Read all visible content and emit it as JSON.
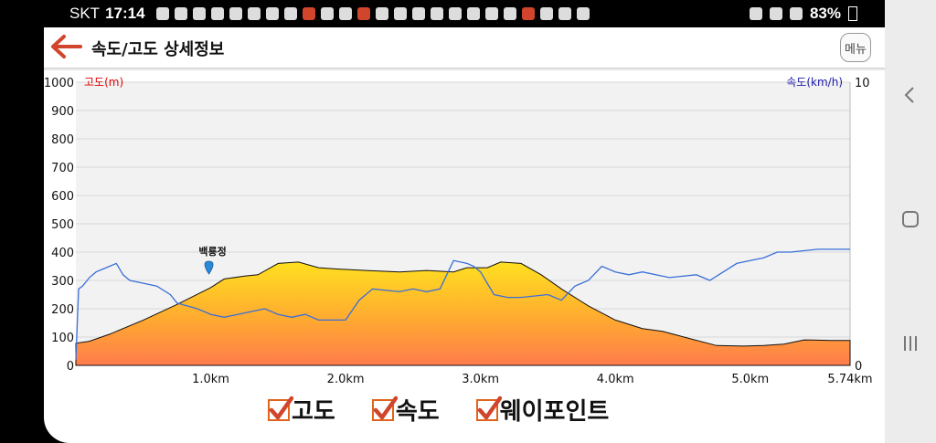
{
  "status_bar": {
    "carrier": "SKT",
    "time": "17:14",
    "battery": "83%"
  },
  "header": {
    "title": "속도/고도 상세정보",
    "menu_label": "메뉴"
  },
  "chart_data": {
    "type": "area",
    "left_axis": {
      "label": "고도(m)",
      "ticks": [
        "1000",
        "900",
        "800",
        "700",
        "600",
        "500",
        "400",
        "300",
        "200",
        "100",
        "0"
      ],
      "range": [
        0,
        1000
      ],
      "color": "#e00000"
    },
    "right_axis": {
      "label": "속도(km/h)",
      "ticks": [
        "10",
        "0"
      ],
      "range": [
        0,
        10
      ],
      "color": "#1a1aa8"
    },
    "x_ticks": [
      "1.0km",
      "2.0km",
      "3.0km",
      "4.0km",
      "5.0km",
      "5.74km"
    ],
    "x_range": [
      0,
      5.74
    ],
    "grid": true,
    "series": [
      {
        "key": "altitude",
        "x": [
          0,
          0.1,
          0.25,
          0.5,
          0.75,
          1.0,
          1.1,
          1.25,
          1.35,
          1.5,
          1.65,
          1.8,
          1.95,
          2.15,
          2.4,
          2.6,
          2.8,
          2.9,
          3.05,
          3.15,
          3.3,
          3.45,
          3.6,
          3.8,
          4.0,
          4.2,
          4.35,
          4.55,
          4.75,
          4.95,
          5.1,
          5.25,
          5.4,
          5.6,
          5.74
        ],
        "values": [
          78,
          85,
          110,
          160,
          215,
          275,
          305,
          315,
          320,
          360,
          365,
          345,
          340,
          335,
          330,
          335,
          330,
          345,
          345,
          365,
          360,
          320,
          270,
          210,
          160,
          130,
          120,
          95,
          70,
          68,
          70,
          75,
          90,
          88,
          88
        ]
      },
      {
        "key": "speed",
        "x": [
          0,
          0.02,
          0.05,
          0.1,
          0.15,
          0.2,
          0.3,
          0.35,
          0.4,
          0.5,
          0.6,
          0.7,
          0.75,
          0.9,
          1.0,
          1.1,
          1.2,
          1.3,
          1.4,
          1.5,
          1.6,
          1.7,
          1.8,
          2.0,
          2.1,
          2.2,
          2.4,
          2.5,
          2.6,
          2.7,
          2.8,
          2.9,
          2.95,
          3.0,
          3.1,
          3.2,
          3.3,
          3.5,
          3.6,
          3.7,
          3.8,
          3.9,
          4.0,
          4.1,
          4.2,
          4.4,
          4.6,
          4.7,
          4.9,
          5.0,
          5.1,
          5.2,
          5.3,
          5.5,
          5.74
        ],
        "values": [
          0.2,
          2.7,
          2.8,
          3.1,
          3.3,
          3.4,
          3.6,
          3.2,
          3.0,
          2.9,
          2.8,
          2.5,
          2.2,
          2.0,
          1.8,
          1.7,
          1.8,
          1.9,
          2.0,
          1.8,
          1.7,
          1.8,
          1.6,
          1.6,
          2.3,
          2.7,
          2.6,
          2.7,
          2.6,
          2.7,
          3.7,
          3.6,
          3.5,
          3.3,
          2.5,
          2.4,
          2.4,
          2.5,
          2.3,
          2.8,
          3.0,
          3.5,
          3.3,
          3.2,
          3.3,
          3.1,
          3.2,
          3.0,
          3.6,
          3.7,
          3.8,
          4.0,
          4.0,
          4.1,
          4.1
        ]
      }
    ],
    "waypoint": {
      "label": "백룡정",
      "x": 1.0
    }
  },
  "legend": {
    "items": [
      {
        "label": "고도"
      },
      {
        "label": "속도"
      },
      {
        "label": "웨이포인트"
      }
    ]
  }
}
